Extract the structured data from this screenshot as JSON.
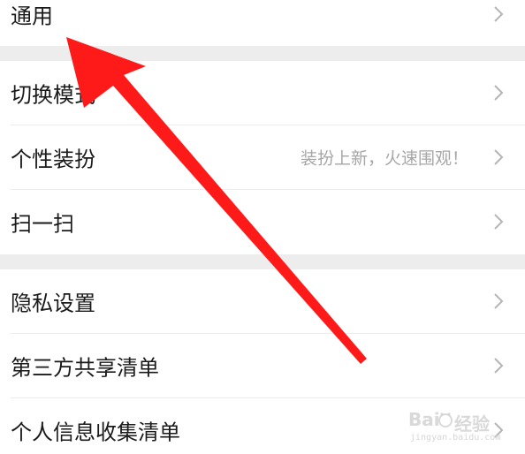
{
  "settings": {
    "rows": [
      {
        "label": "通用",
        "hint": ""
      },
      {
        "label": "切换模式",
        "hint": ""
      },
      {
        "label": "个性装扮",
        "hint": "装扮上新，火速围观！"
      },
      {
        "label": "扫一扫",
        "hint": ""
      },
      {
        "label": "隐私设置",
        "hint": ""
      },
      {
        "label": "第三方共享清单",
        "hint": ""
      },
      {
        "label": "个人信息收集清单",
        "hint": ""
      }
    ]
  },
  "annotation": {
    "arrow_color": "#ff1a1a"
  },
  "watermark": {
    "brand": "经验",
    "url": "jingyan.baidu.com"
  }
}
